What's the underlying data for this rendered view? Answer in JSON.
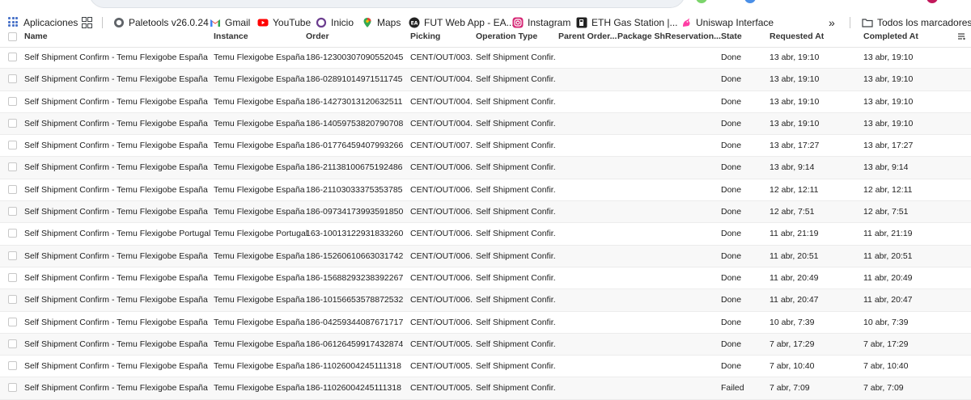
{
  "bookmarks": {
    "items": [
      {
        "label": "Aplicaciones",
        "icon": "apps-grid-icon"
      },
      {
        "label": "",
        "icon": "tab-groups-icon"
      },
      {
        "label": "Paletools v26.0.24",
        "icon": "globe-icon"
      },
      {
        "label": "Gmail",
        "icon": "gmail-icon"
      },
      {
        "label": "YouTube",
        "icon": "youtube-icon"
      },
      {
        "label": "Inicio",
        "icon": "ring-icon"
      },
      {
        "label": "Maps",
        "icon": "maps-pin-icon"
      },
      {
        "label": "FUT Web App - EA...",
        "icon": "ea-icon"
      },
      {
        "label": "Instagram",
        "icon": "instagram-icon"
      },
      {
        "label": "ETH Gas Station |...",
        "icon": "gas-station-icon"
      },
      {
        "label": "Uniswap Interface",
        "icon": "unicorn-icon"
      }
    ],
    "more": "»",
    "all_bookmarks": "Todos los marcadores"
  },
  "table": {
    "columns": [
      "Name",
      "Instance",
      "Order",
      "Picking",
      "Operation Type",
      "Parent Order...",
      "Package Sh",
      "Reservation...",
      "State",
      "Requested At",
      "Completed At"
    ],
    "rows": [
      {
        "name": "Self Shipment Confirm - Temu Flexigobe España",
        "instance": "Temu Flexigobe España",
        "order": "186-12300307090552045",
        "picking": "CENT/OUT/003...",
        "op": "Self Shipment Confir...",
        "state": "Done",
        "requested": "13 abr, 19:10",
        "completed": "13 abr, 19:10"
      },
      {
        "name": "Self Shipment Confirm - Temu Flexigobe España",
        "instance": "Temu Flexigobe España",
        "order": "186-02891014971511745",
        "picking": "CENT/OUT/004...",
        "op": "Self Shipment Confir...",
        "state": "Done",
        "requested": "13 abr, 19:10",
        "completed": "13 abr, 19:10"
      },
      {
        "name": "Self Shipment Confirm - Temu Flexigobe España",
        "instance": "Temu Flexigobe España",
        "order": "186-14273013120632511",
        "picking": "CENT/OUT/004...",
        "op": "Self Shipment Confir...",
        "state": "Done",
        "requested": "13 abr, 19:10",
        "completed": "13 abr, 19:10"
      },
      {
        "name": "Self Shipment Confirm - Temu Flexigobe España",
        "instance": "Temu Flexigobe España",
        "order": "186-14059753820790708",
        "picking": "CENT/OUT/004...",
        "op": "Self Shipment Confir...",
        "state": "Done",
        "requested": "13 abr, 19:10",
        "completed": "13 abr, 19:10"
      },
      {
        "name": "Self Shipment Confirm - Temu Flexigobe España",
        "instance": "Temu Flexigobe España",
        "order": "186-01776459407993266",
        "picking": "CENT/OUT/007...",
        "op": "Self Shipment Confir...",
        "state": "Done",
        "requested": "13 abr, 17:27",
        "completed": "13 abr, 17:27"
      },
      {
        "name": "Self Shipment Confirm - Temu Flexigobe España",
        "instance": "Temu Flexigobe España",
        "order": "186-21138100675192486",
        "picking": "CENT/OUT/006...",
        "op": "Self Shipment Confir...",
        "state": "Done",
        "requested": "13 abr, 9:14",
        "completed": "13 abr, 9:14"
      },
      {
        "name": "Self Shipment Confirm - Temu Flexigobe España",
        "instance": "Temu Flexigobe España",
        "order": "186-21103033375353785",
        "picking": "CENT/OUT/006...",
        "op": "Self Shipment Confir...",
        "state": "Done",
        "requested": "12 abr, 12:11",
        "completed": "12 abr, 12:11"
      },
      {
        "name": "Self Shipment Confirm - Temu Flexigobe España",
        "instance": "Temu Flexigobe España",
        "order": "186-09734173993591850",
        "picking": "CENT/OUT/006...",
        "op": "Self Shipment Confir...",
        "state": "Done",
        "requested": "12 abr, 7:51",
        "completed": "12 abr, 7:51"
      },
      {
        "name": "Self Shipment Confirm - Temu Flexigobe Portugal",
        "instance": "Temu Flexigobe Portugal",
        "order": "163-10013122931833260",
        "picking": "CENT/OUT/006...",
        "op": "Self Shipment Confir...",
        "state": "Done",
        "requested": "11 abr, 21:19",
        "completed": "11 abr, 21:19"
      },
      {
        "name": "Self Shipment Confirm - Temu Flexigobe España",
        "instance": "Temu Flexigobe España",
        "order": "186-15260610663031742",
        "picking": "CENT/OUT/006...",
        "op": "Self Shipment Confir...",
        "state": "Done",
        "requested": "11 abr, 20:51",
        "completed": "11 abr, 20:51"
      },
      {
        "name": "Self Shipment Confirm - Temu Flexigobe España",
        "instance": "Temu Flexigobe España",
        "order": "186-15688293238392267",
        "picking": "CENT/OUT/006...",
        "op": "Self Shipment Confir...",
        "state": "Done",
        "requested": "11 abr, 20:49",
        "completed": "11 abr, 20:49"
      },
      {
        "name": "Self Shipment Confirm - Temu Flexigobe España",
        "instance": "Temu Flexigobe España",
        "order": "186-10156653578872532",
        "picking": "CENT/OUT/006...",
        "op": "Self Shipment Confir...",
        "state": "Done",
        "requested": "11 abr, 20:47",
        "completed": "11 abr, 20:47"
      },
      {
        "name": "Self Shipment Confirm - Temu Flexigobe España",
        "instance": "Temu Flexigobe España",
        "order": "186-04259344087671717",
        "picking": "CENT/OUT/006...",
        "op": "Self Shipment Confir...",
        "state": "Done",
        "requested": "10 abr, 7:39",
        "completed": "10 abr, 7:39"
      },
      {
        "name": "Self Shipment Confirm - Temu Flexigobe España",
        "instance": "Temu Flexigobe España",
        "order": "186-06126459917432874",
        "picking": "CENT/OUT/005...",
        "op": "Self Shipment Confir...",
        "state": "Done",
        "requested": "7 abr, 17:29",
        "completed": "7 abr, 17:29"
      },
      {
        "name": "Self Shipment Confirm - Temu Flexigobe España",
        "instance": "Temu Flexigobe España",
        "order": "186-11026004245111318",
        "picking": "CENT/OUT/005...",
        "op": "Self Shipment Confir...",
        "state": "Done",
        "requested": "7 abr, 10:40",
        "completed": "7 abr, 10:40"
      },
      {
        "name": "Self Shipment Confirm - Temu Flexigobe España",
        "instance": "Temu Flexigobe España",
        "order": "186-11026004245111318",
        "picking": "CENT/OUT/005...",
        "op": "Self Shipment Confir...",
        "state": "Failed",
        "requested": "7 abr, 7:09",
        "completed": "7 abr, 7:09"
      }
    ]
  }
}
